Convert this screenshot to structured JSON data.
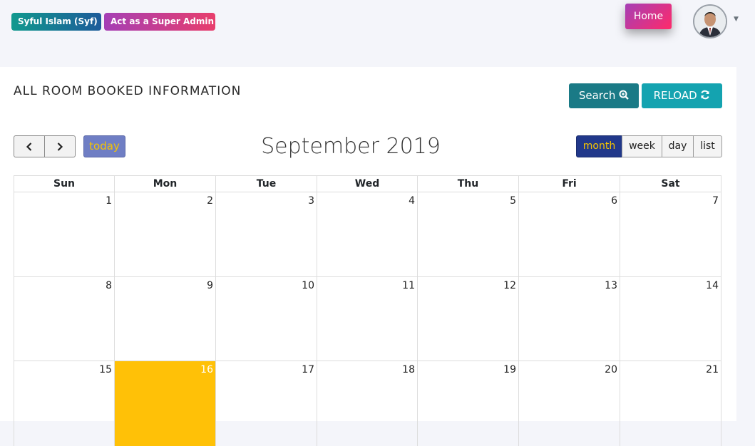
{
  "header": {
    "user_badge": "Syful Islam (Syf)",
    "role_badge": "Act as a Super Admin",
    "home_label": "Home"
  },
  "card": {
    "title": "ALL ROOM BOOKED INFORMATION",
    "search_label": "Search",
    "reload_label": "RELOAD"
  },
  "calendar": {
    "today_label": "today",
    "month_title": "September 2019",
    "views": {
      "month": "month",
      "week": "week",
      "day": "day",
      "list": "list"
    },
    "active_view": "month",
    "weekdays": [
      "Sun",
      "Mon",
      "Tue",
      "Wed",
      "Thu",
      "Fri",
      "Sat"
    ],
    "weeks": [
      [
        "1",
        "2",
        "3",
        "4",
        "5",
        "6",
        "7"
      ],
      [
        "8",
        "9",
        "10",
        "11",
        "12",
        "13",
        "14"
      ],
      [
        "15",
        "16",
        "17",
        "18",
        "19",
        "20",
        "21"
      ]
    ],
    "highlighted_day": "16",
    "colors": {
      "today_bg": "#ffc107",
      "active_view_bg": "#21388a",
      "accent_text": "#f5c400"
    }
  }
}
